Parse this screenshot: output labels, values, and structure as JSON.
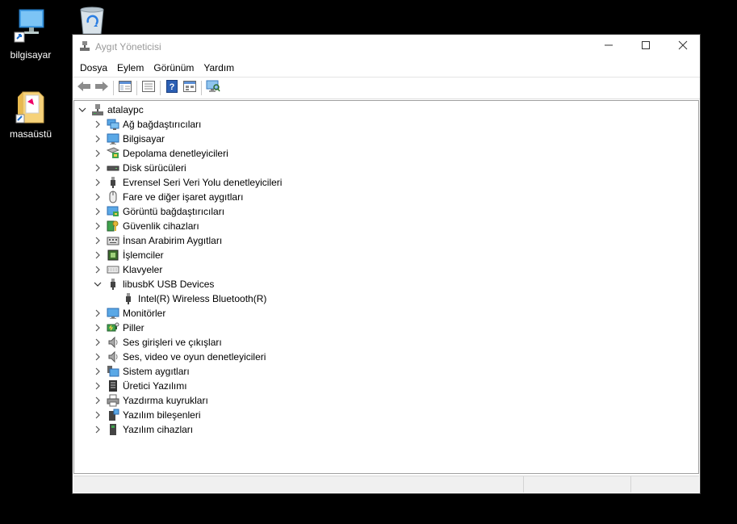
{
  "desktop": {
    "icons": [
      {
        "label": "bilgisayar",
        "icon": "computer-icon"
      },
      {
        "label": "masaüstü",
        "icon": "folder-icon"
      },
      {
        "label": "",
        "icon": "recycle-bin-icon"
      }
    ]
  },
  "window": {
    "title": "Aygıt Yöneticisi",
    "controls": [
      "minimize-icon",
      "maximize-icon",
      "close-icon"
    ]
  },
  "menu": [
    "Dosya",
    "Eylem",
    "Görünüm",
    "Yardım"
  ],
  "toolbar": [
    "back-arrow-icon",
    "forward-arrow-icon",
    "show-hide-console-tree-icon",
    "properties-icon",
    "help-icon",
    "console-view-icon",
    "scan-hardware-icon"
  ],
  "tree": {
    "root": {
      "label": "atalaypc",
      "icon": "computer-tower-icon",
      "expanded": true
    },
    "items": [
      {
        "label": "Ağ bağdaştırıcıları",
        "icon": "network-adapter-icon",
        "expanded": false
      },
      {
        "label": "Bilgisayar",
        "icon": "monitor-icon",
        "expanded": false
      },
      {
        "label": "Depolama denetleyicileri",
        "icon": "storage-controller-icon",
        "expanded": false
      },
      {
        "label": "Disk sürücüleri",
        "icon": "disk-drive-icon",
        "expanded": false
      },
      {
        "label": "Evrensel Seri Veri Yolu denetleyicileri",
        "icon": "usb-icon",
        "expanded": false
      },
      {
        "label": "Fare ve diğer işaret aygıtları",
        "icon": "mouse-icon",
        "expanded": false
      },
      {
        "label": "Görüntü bağdaştırıcıları",
        "icon": "display-adapter-icon",
        "expanded": false
      },
      {
        "label": "Güvenlik cihazları",
        "icon": "security-key-icon",
        "expanded": false
      },
      {
        "label": "İnsan Arabirim Aygıtları",
        "icon": "hid-icon",
        "expanded": false
      },
      {
        "label": "İşlemciler",
        "icon": "processor-icon",
        "expanded": false
      },
      {
        "label": "Klavyeler",
        "icon": "keyboard-icon",
        "expanded": false
      },
      {
        "label": "libusbK USB Devices",
        "icon": "usb-icon",
        "expanded": true,
        "children": [
          {
            "label": "Intel(R) Wireless Bluetooth(R)",
            "icon": "usb-icon"
          }
        ]
      },
      {
        "label": "Monitörler",
        "icon": "monitor-icon",
        "expanded": false
      },
      {
        "label": "Piller",
        "icon": "battery-icon",
        "expanded": false
      },
      {
        "label": "Ses girişleri ve çıkışları",
        "icon": "speaker-icon",
        "expanded": false
      },
      {
        "label": "Ses, video ve oyun denetleyicileri",
        "icon": "speaker-icon",
        "expanded": false
      },
      {
        "label": "Sistem aygıtları",
        "icon": "system-devices-icon",
        "expanded": false
      },
      {
        "label": "Üretici Yazılımı",
        "icon": "firmware-icon",
        "expanded": false
      },
      {
        "label": "Yazdırma kuyrukları",
        "icon": "printer-icon",
        "expanded": false
      },
      {
        "label": "Yazılım bileşenleri",
        "icon": "software-component-icon",
        "expanded": false
      },
      {
        "label": "Yazılım cihazları",
        "icon": "software-device-icon",
        "expanded": false
      }
    ]
  },
  "colors": {
    "accent": "#1e88e5",
    "title_text": "#999999",
    "desktop": "#000000"
  }
}
